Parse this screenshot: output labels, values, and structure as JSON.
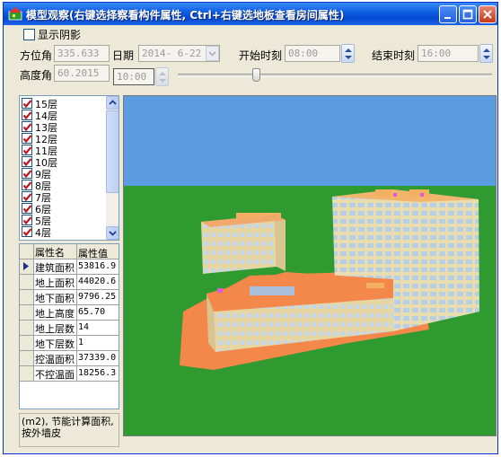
{
  "window": {
    "title": "模型观察(右键选择察看构件属性, Ctrl+右键选地板查看房间属性)"
  },
  "controls": {
    "show_shadow_label": "显示阴影",
    "show_shadow_checked": false,
    "azimuth_label": "方位角",
    "azimuth_value": "335.633",
    "date_label": "日期",
    "date_value": "2014- 6-22",
    "start_time_label": "开始时刻",
    "start_time_value": "08:00",
    "end_time_label": "结束时刻",
    "end_time_value": "16:00",
    "altitude_label": "高度角",
    "altitude_value": "60.2015",
    "current_time_value": "10:00"
  },
  "floors": {
    "items": [
      {
        "label": "15层",
        "checked": true
      },
      {
        "label": "14层",
        "checked": true
      },
      {
        "label": "13层",
        "checked": true
      },
      {
        "label": "12层",
        "checked": true
      },
      {
        "label": "11层",
        "checked": true
      },
      {
        "label": "10层",
        "checked": true
      },
      {
        "label": "9层",
        "checked": true
      },
      {
        "label": "8层",
        "checked": true
      },
      {
        "label": "7层",
        "checked": true
      },
      {
        "label": "6层",
        "checked": true
      },
      {
        "label": "5层",
        "checked": true
      },
      {
        "label": "4层",
        "checked": true
      }
    ]
  },
  "properties": {
    "header": {
      "name": "属性名",
      "value": "属性值"
    },
    "selected_index": 0,
    "rows": [
      {
        "name": "建筑面积",
        "value": "53816.9"
      },
      {
        "name": "地上面积",
        "value": "44020.6"
      },
      {
        "name": "地下面积",
        "value": "9796.25"
      },
      {
        "name": "地上高度",
        "value": "65.70"
      },
      {
        "name": "地上层数",
        "value": "14"
      },
      {
        "name": "地下层数",
        "value": "1"
      },
      {
        "name": "控温面积",
        "value": "37339.0"
      },
      {
        "name": "不控温面",
        "value": "18256.3"
      }
    ]
  },
  "description": "(m2), 节能计算面积, 按外墙皮",
  "colors": {
    "sky": "#5b9be0",
    "ground": "#2f9a2f",
    "podium_roof": "#f4874a",
    "facade": "#e8d9a8",
    "window_blue": "#bcd3e8",
    "accent_pink": "#e05ad6"
  }
}
